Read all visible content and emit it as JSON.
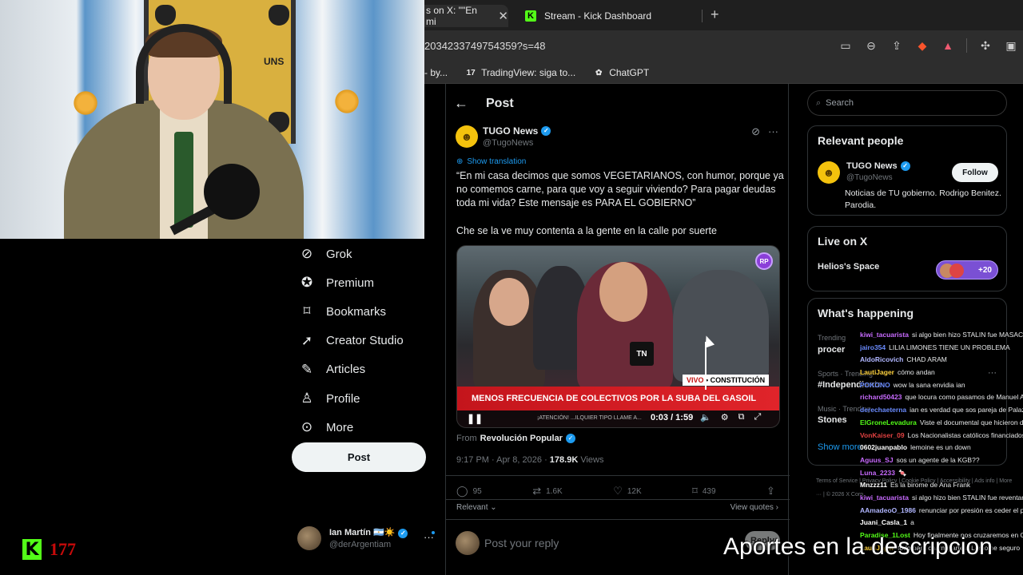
{
  "browser": {
    "tabs": [
      {
        "label": "s on X: \"\"En mi",
        "close": "✕"
      },
      {
        "label": "Stream - Kick Dashboard",
        "badge": "K"
      }
    ],
    "new_tab": "+",
    "url": "2034233749754359?s=48",
    "bookmarks": [
      {
        "label": "- by..."
      },
      {
        "label": "TradingView: siga to...",
        "badge": "17"
      },
      {
        "label": "ChatGPT"
      }
    ],
    "colors": {
      "kick": "#53fc18",
      "brave": "#fb542b"
    }
  },
  "webcam": {
    "banner_text": "UNS"
  },
  "nav": {
    "items": [
      {
        "label": "Grok",
        "icon": "grok-icon"
      },
      {
        "label": "Premium",
        "icon": "premium-icon"
      },
      {
        "label": "Bookmarks",
        "icon": "bookmark-icon"
      },
      {
        "label": "Creator Studio",
        "icon": "rocket-icon"
      },
      {
        "label": "Articles",
        "icon": "article-icon"
      },
      {
        "label": "Profile",
        "icon": "person-icon"
      },
      {
        "label": "More",
        "icon": "more-circle-icon"
      }
    ],
    "post_button": "Post",
    "account": {
      "name": "Ian Martín 🇦🇷☀️",
      "handle": "@derArgentiam"
    }
  },
  "post": {
    "header_title": "Post",
    "author": {
      "name": "TUGO News",
      "handle": "@TugoNews",
      "avatar_letter": "☻"
    },
    "show_translation": "Show translation",
    "quote": "“En mi casa decimos que somos VEGETARIANOS, con humor, porque ya no comemos carne, para que voy a seguir viviendo? Para pagar deudas toda mi vida? Este mensaje es PARA EL GOBIERNO”",
    "body": "Che se la ve muy contenta a la gente en la calle por suerte",
    "video": {
      "badge": "RP",
      "channel_logo": "TN",
      "live_prefix": "VIVO",
      "live_location": "CONSTITUCIÓN",
      "ticker": "MENOS FRECUENCIA DE COLECTIVOS POR LA SUBA DEL GASOIL",
      "ticker_sub": "¡ATENCIÓN! ...ILQUIER TIPO LLAME A...",
      "time": "0:03 / 1:59"
    },
    "from_label": "From",
    "from_source": "Revolución Popular",
    "timestamp": "9:17 PM · Apr 8, 2026 · ",
    "views": "178.9K",
    "views_label": " Views",
    "stats": {
      "replies": "95",
      "reposts": "1.6K",
      "likes": "12K",
      "bookmarks": "439"
    },
    "relevant": "Relevant ⌄",
    "view_quotes": "View quotes ›",
    "reply_placeholder": "Post your reply",
    "reply_button": "Reply"
  },
  "sidebar": {
    "search_placeholder": "Search",
    "relevant_title": "Relevant people",
    "relevant_person": {
      "name": "TUGO News",
      "handle": "@TugoNews",
      "bio": "Noticias de TU gobierno. Rodrigo Benitez. Parodia.",
      "follow": "Follow"
    },
    "live_title": "Live on X",
    "live_space": "Helios's Space",
    "live_count": "+20",
    "happening_title": "What's happening",
    "trends": [
      {
        "category": "Trending",
        "name": "procer"
      },
      {
        "category": "Sports · Trending",
        "name": "#Independiente"
      },
      {
        "category": "Music · Trending",
        "name": "Stones"
      }
    ],
    "show_more": "Show more",
    "footer": "Terms of Service | Privacy Policy | Cookie Policy | Accessibility | Ads info | More ··· | © 2026 X Corp."
  },
  "chat": [
    {
      "user": "kiwi_tacuarista",
      "color": "#c86bff",
      "text": "si algo bien hizo STALIN fue MASACRAR"
    },
    {
      "user": "jairo354",
      "color": "#6b8cff",
      "text": "LILIA LIMONES TIENE UN PROBLEMA"
    },
    {
      "user": "AldoRicovich",
      "color": "#b0b6ff",
      "text": "CHAD ARAM"
    },
    {
      "user": "LautiJager",
      "color": "#ffd23f",
      "text": "cómo andan"
    },
    {
      "user": "POKONO",
      "color": "#6b8cff",
      "text": "wow la sana envidia ian"
    },
    {
      "user": "richard50423",
      "color": "#c86bff",
      "text": "que locura como pasamos de Manuel A"
    },
    {
      "user": "derechaeterna",
      "color": "#6b8cff",
      "text": "ian es verdad que sos pareja de Palaz"
    },
    {
      "user": "ElGroneLevadura",
      "color": "#53fc18",
      "text": "Viste el documental que hicieron de"
    },
    {
      "user": "VonKaiser_09",
      "color": "#e04141",
      "text": "Los Nacionalistas católicos financiados"
    },
    {
      "user": "0602juanpablo",
      "color": "#ffffff",
      "text": "lemoine es un down"
    },
    {
      "user": "Aguus_SJ",
      "color": "#c86bff",
      "text": "sos un agente de la KGB??"
    },
    {
      "user": "Luna_2233",
      "color": "#c86bff",
      "text": "🍬"
    },
    {
      "user": "Mnzzz11",
      "color": "#ffffff",
      "text": "Es la birome de Ana Frank"
    },
    {
      "user": "kiwi_tacuarista",
      "color": "#c86bff",
      "text": "si algo hizo bien STALIN fue reventar"
    },
    {
      "user": "AAmadeoO_1986",
      "color": "#b0b6ff",
      "text": "renunciar por presión es ceder el po"
    },
    {
      "user": "Juani_Casla_1",
      "color": "#ffffff",
      "text": "a"
    },
    {
      "user": "Paradise_1Lost",
      "color": "#53fc18",
      "text": "Hoy finalmente nos cruzaremos en O"
    },
    {
      "user": "LautiJager",
      "color": "#ffd23f",
      "text": "todo para chamuyarte a Lemoine seguro"
    }
  ],
  "overlay": {
    "kick_letter": "K",
    "viewer_count": "177",
    "donations_text": "Aportes en la descripcion"
  }
}
